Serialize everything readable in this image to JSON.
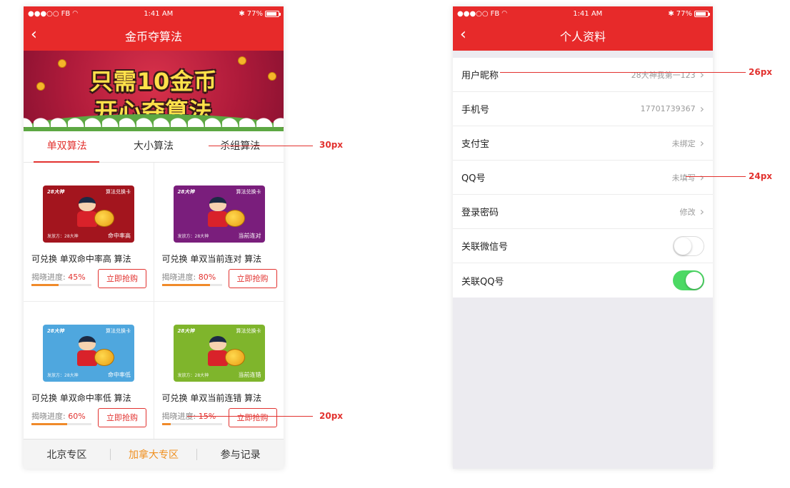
{
  "status_bar": {
    "carrier": "FB",
    "time": "1:41 AM",
    "battery": "77%"
  },
  "left": {
    "title": "金币夺算法",
    "banner": {
      "line1": "只需10金币",
      "line2": "开心夺算法"
    },
    "tabs": [
      {
        "label": "单双算法",
        "active": true
      },
      {
        "label": "大小算法",
        "active": false
      },
      {
        "label": "杀组算法",
        "active": false
      }
    ],
    "items": [
      {
        "brand": "28大神",
        "card_title": "算法兑换卡",
        "issuer": "发放方：28大神",
        "metric": "命中率高",
        "card_color": "#a3151e",
        "name": "可兑换 单双命中率高 算法",
        "progress_label": "揭晓进度:",
        "progress_text": "45%",
        "progress": 0.45,
        "button": "立即抢购"
      },
      {
        "brand": "28大神",
        "card_title": "算法兑换卡",
        "issuer": "发放方：28大神",
        "metric": "当前连对",
        "card_color": "#7a1e7c",
        "name": "可兑换 单双当前连对 算法",
        "progress_label": "揭晓进度:",
        "progress_text": "80%",
        "progress": 0.8,
        "button": "立即抢购"
      },
      {
        "brand": "28大神",
        "card_title": "算法兑换卡",
        "issuer": "发放方：28大神",
        "metric": "命中率低",
        "card_color": "#4fa7de",
        "name": "可兑换 单双命中率低 算法",
        "progress_label": "揭晓进度:",
        "progress_text": "60%",
        "progress": 0.6,
        "button": "立即抢购"
      },
      {
        "brand": "28大神",
        "card_title": "算法兑换卡",
        "issuer": "发放方：28大神",
        "metric": "当前连错",
        "card_color": "#7fb52c",
        "name": "可兑换 单双当前连错 算法",
        "progress_label": "揭晓进度:",
        "progress_text": "15%",
        "progress": 0.15,
        "button": "立即抢购"
      }
    ],
    "bottom_bar": [
      {
        "label": "北京专区",
        "active": false
      },
      {
        "label": "加拿大专区",
        "active": true
      },
      {
        "label": "参与记录",
        "active": false
      }
    ]
  },
  "right": {
    "title": "个人资料",
    "rows": [
      {
        "label": "用户昵称",
        "value": "28大神我第一123"
      },
      {
        "label": "手机号",
        "value": "17701739367"
      },
      {
        "label": "支付宝",
        "value": "未绑定"
      },
      {
        "label": "QQ号",
        "value": "未填写"
      },
      {
        "label": "登录密码",
        "value": "修改"
      }
    ],
    "toggles": [
      {
        "label": "关联微信号",
        "on": false
      },
      {
        "label": "关联QQ号",
        "on": true
      }
    ]
  },
  "annotations": [
    "30px",
    "26px",
    "24px",
    "20px"
  ],
  "colors": {
    "brand_red": "#e72a2a",
    "accent_orange": "#f09020",
    "toggle_green": "#4cd964"
  }
}
